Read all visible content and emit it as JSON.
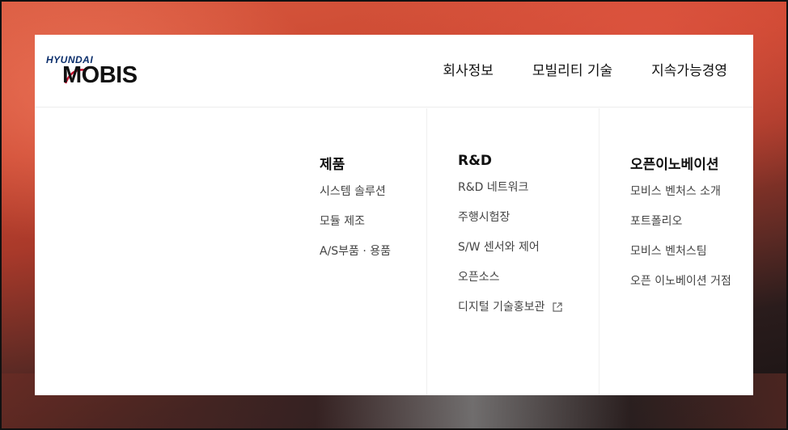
{
  "logo": {
    "brand_top": "HYUNDAI",
    "brand_main": "MOBIS"
  },
  "nav": {
    "items": [
      {
        "label": "회사정보"
      },
      {
        "label": "모빌리티 기술"
      },
      {
        "label": "지속가능경영"
      }
    ]
  },
  "menu": {
    "columns": [
      {
        "title": "제품",
        "items": [
          "시스템 솔루션",
          "모듈 제조",
          "A/S부품 · 용품"
        ]
      },
      {
        "title": "R&D",
        "items": [
          "R&D 네트워크",
          "주행시험장",
          "S/W 센서와 제어",
          "오픈소스",
          "디지털 기술홍보관"
        ]
      },
      {
        "title": "오픈이노베이션",
        "items": [
          "모비스 벤처스 소개",
          "포트폴리오",
          "모비스 벤처스팀",
          "오픈 이노베이션 거점"
        ]
      }
    ]
  },
  "icons": {
    "external_link": "external-link-icon"
  },
  "colors": {
    "brand_navy": "#0b2e6b",
    "brand_red": "#c8102e",
    "panel_bg": "#ffffff"
  }
}
